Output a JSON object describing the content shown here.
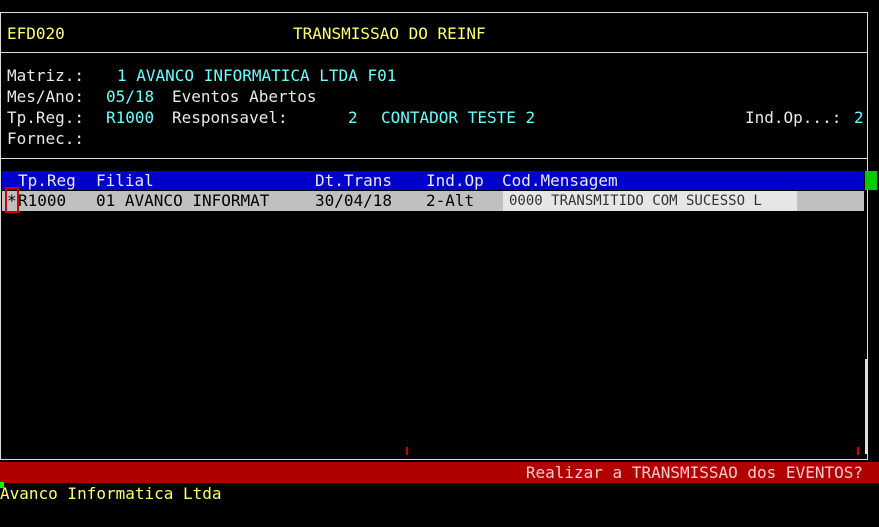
{
  "header": {
    "program": "EFD020",
    "title": "TRANSMISSAO DO REINF"
  },
  "info": {
    "matriz_label": "Matriz.:",
    "matriz_value": "1 AVANCO INFORMATICA LTDA F01",
    "mesano_label": "Mes/Ano:",
    "mesano_value": "05/18",
    "eventos": "Eventos Abertos",
    "tpreg_label": "Tp.Reg.:",
    "tpreg_value": "R1000",
    "resp_label": "Responsavel:",
    "resp_num": "2",
    "resp_name": "CONTADOR TESTE 2",
    "indop_label": "Ind.Op...:",
    "indop_value": "2",
    "fornec_label": "Fornec.:"
  },
  "table": {
    "columns": [
      "Tp.Reg",
      "Filial",
      "Dt.Trans",
      "Ind.Op",
      "Cod.Mensagem"
    ],
    "rows": [
      {
        "mark": "*",
        "tpreg": "R1000",
        "filial": "01 AVANCO INFORMAT",
        "dttrans": "30/04/18",
        "indop": "2-Alt",
        "codmsg": "0000 TRANSMITIDO COM SUCESSO L"
      }
    ]
  },
  "status": {
    "prompt": "Realizar a TRANSMISSAO dos EVENTOS?"
  },
  "footer": {
    "company": "Avanco Informatica Ltda"
  },
  "colors": {
    "background": "#000000",
    "header_bar": "#0000cc",
    "status_bar": "#b00000",
    "text_yellow": "#ffff66",
    "text_cyan": "#66ffff"
  }
}
